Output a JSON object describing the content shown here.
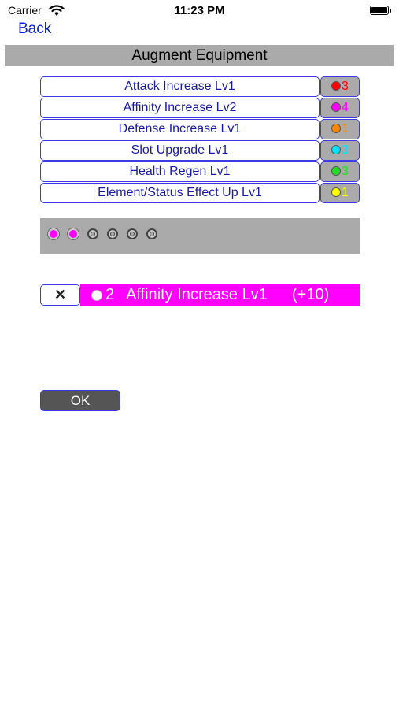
{
  "status_bar": {
    "carrier": "Carrier",
    "time": "11:23 PM"
  },
  "nav": {
    "back_label": "Back"
  },
  "title": "Augment Equipment",
  "skills": [
    {
      "name": "Attack Increase Lv1",
      "cost": "3",
      "color": "#ff0000"
    },
    {
      "name": "Affinity Increase Lv2",
      "cost": "4",
      "color": "#ff00ff"
    },
    {
      "name": "Defense Increase Lv1",
      "cost": "1",
      "color": "#ff8800"
    },
    {
      "name": "Slot Upgrade Lv1",
      "cost": "3",
      "color": "#00e5ff"
    },
    {
      "name": "Health Regen Lv1",
      "cost": "3",
      "color": "#22dd22"
    },
    {
      "name": "Element/Status Effect Up Lv1",
      "cost": "1",
      "color": "#ffff00"
    }
  ],
  "slots": {
    "total": 6,
    "filled": 2,
    "filled_color": "#ff00ff"
  },
  "selected": {
    "count": "2",
    "name": "Affinity Increase Lv1",
    "bonus": "(+10)",
    "color": "#ff00ff"
  },
  "remove_label": "✕",
  "ok_label": "OK"
}
